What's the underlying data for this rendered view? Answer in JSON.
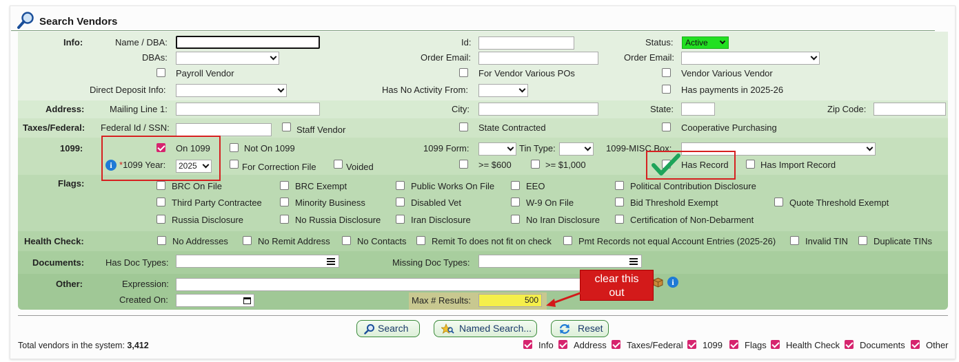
{
  "title": "Search Vendors",
  "info": {
    "section": "Info:",
    "name_label": "Name / DBA:",
    "name_value": "",
    "id_label": "Id:",
    "status_label": "Status:",
    "status_value": "Active",
    "dbas_label": "DBAs:",
    "order_email_label": "Order Email:",
    "order_email2_label": "Order Email:",
    "payroll_vendor": "Payroll Vendor",
    "for_vendor_various": "For Vendor Various POs",
    "vendor_various_vendor": "Vendor Various Vendor",
    "direct_deposit_label": "Direct Deposit Info:",
    "no_activity_label": "Has No Activity From:",
    "has_payments": "Has payments in 2025-26"
  },
  "address": {
    "section": "Address:",
    "mailing_label": "Mailing Line 1:",
    "city_label": "City:",
    "state_label": "State:",
    "zip_label": "Zip Code:"
  },
  "taxes": {
    "section": "Taxes/Federal:",
    "fedid_label": "Federal Id / SSN:",
    "staff_vendor": "Staff Vendor",
    "state_contracted": "State Contracted",
    "coop_purchasing": "Cooperative Purchasing"
  },
  "f1099": {
    "section": "1099:",
    "on_1099": "On 1099",
    "not_on_1099": "Not On 1099",
    "form_label": "1099 Form:",
    "tin_label": "Tin Type:",
    "misc_label": "1099-MISC Box:",
    "year_label": "1099 Year:",
    "year_star": "*",
    "year_value": "2025",
    "for_correction": "For Correction File",
    "voided": "Voided",
    "gte_600": ">= $600",
    "gte_1000": ">= $1,000",
    "has_record": "Has Record",
    "has_import_record": "Has Import Record"
  },
  "flags": {
    "section": "Flags:",
    "items": [
      "BRC On File",
      "BRC Exempt",
      "Public Works On File",
      "EEO",
      "Political Contribution Disclosure",
      "Third Party Contractee",
      "Minority Business",
      "Disabled Vet",
      "W-9 On File",
      "Bid Threshold Exempt",
      "Quote Threshold Exempt",
      "Russia Disclosure",
      "No Russia Disclosure",
      "Iran Disclosure",
      "No Iran Disclosure",
      "Certification of Non-Debarment"
    ]
  },
  "health": {
    "section": "Health Check:",
    "items": [
      "No Addresses",
      "No Remit Address",
      "No Contacts",
      "Remit To does not fit on check",
      "Pmt Records not equal Account Entries (2025-26)",
      "Invalid TIN",
      "Duplicate TINs"
    ]
  },
  "docs": {
    "section": "Documents:",
    "has_label": "Has Doc Types:",
    "missing_label": "Missing Doc Types:"
  },
  "other": {
    "section": "Other:",
    "expression_label": "Expression:",
    "created_label": "Created On:",
    "max_label": "Max # Results:",
    "max_value": "500"
  },
  "callout": {
    "line1": "clear this",
    "line2": "out"
  },
  "buttons": {
    "search": "Search",
    "named": "Named Search...",
    "reset": "Reset"
  },
  "footer": {
    "total_label": "Total vendors in the system:",
    "total_value": "3,412",
    "toggles": [
      "Info",
      "Address",
      "Taxes/Federal",
      "1099",
      "Flags",
      "Health Check",
      "Documents",
      "Other"
    ]
  },
  "colors": {
    "status_active": "#22e022",
    "checkbox_on": "#d6246e",
    "annotation_red": "#d62020",
    "max_field": "#f5ef4a"
  }
}
